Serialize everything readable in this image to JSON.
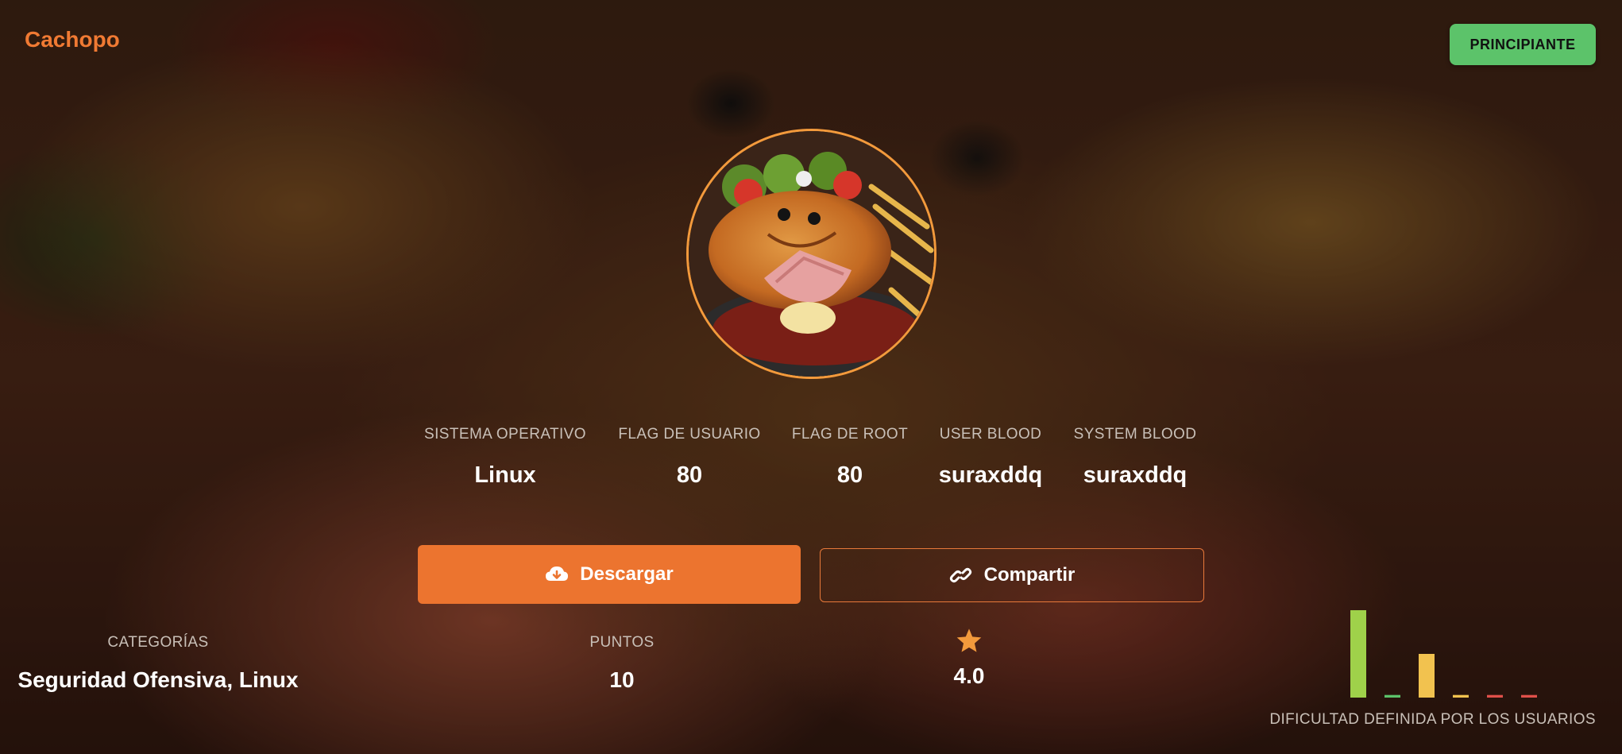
{
  "header": {
    "title": "Cachopo",
    "level_badge": "PRINCIPIANTE"
  },
  "avatar": {
    "icon": "cachopo-plate-image"
  },
  "stats": [
    {
      "label": "SISTEMA OPERATIVO",
      "value": "Linux"
    },
    {
      "label": "FLAG DE USUARIO",
      "value": "80"
    },
    {
      "label": "FLAG DE ROOT",
      "value": "80"
    },
    {
      "label": "USER BLOOD",
      "value": "suraxddq"
    },
    {
      "label": "SYSTEM BLOOD",
      "value": "suraxddq"
    }
  ],
  "actions": {
    "download_label": "Descargar",
    "download_icon": "cloud-download-icon",
    "share_label": "Compartir",
    "share_icon": "link-icon"
  },
  "details": {
    "categories_label": "CATEGORÍAS",
    "categories_value": "Seguridad Ofensiva, Linux",
    "points_label": "PUNTOS",
    "points_value": "10",
    "rating_icon": "star-icon",
    "rating_value": "4.0"
  },
  "difficulty": {
    "caption": "DIFICULTAD DEFINIDA POR LOS USUARIOS",
    "colors": [
      "#9fd14a",
      "#5cc36a",
      "#f2c24f",
      "#f2c24f",
      "#e0504a",
      "#e0504a"
    ],
    "values": [
      1.0,
      0.03,
      0.5,
      0.03,
      0.03,
      0.03
    ]
  },
  "colors": {
    "accent": "#ec742f",
    "badge": "#5cc36a",
    "star": "#f39a3c"
  }
}
